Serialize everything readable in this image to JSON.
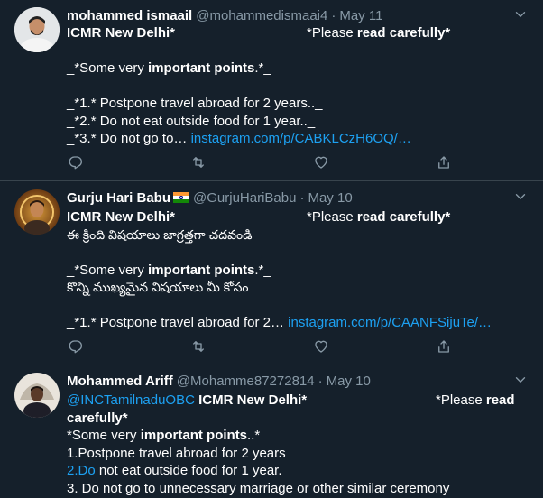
{
  "tweets": [
    {
      "name": "mohammed ismaail",
      "handle": "@mohammedismaai4",
      "dot": "·",
      "date": "May 11",
      "lines": {
        "l1a": "ICMR New Delhi*",
        "l1b": "*Please ",
        "l1c": "read carefully*",
        "l3a": "_*Some very ",
        "l3b": "important points",
        "l3c": ".*_",
        "l5": "_*1.* Postpone travel abroad for 2 years.._",
        "l6": "_*2.* Do not eat outside food for 1 year.._",
        "l7a": "_*3.* Do not go to… ",
        "l7b": "instagram.com/p/CABKLCzH6OQ/…"
      }
    },
    {
      "name": "Gurju Hari Babu",
      "flag": "india-flag",
      "handle": "@GurjuHariBabu",
      "dot": "·",
      "date": "May 10",
      "lines": {
        "l1a": "ICMR New Delhi*",
        "l1b": "*Please ",
        "l1c": "read carefully*",
        "l2": "ఈ క్రింది విషయాలు జాగ్రత్తగా చదవండి",
        "l4a": "_*Some very ",
        "l4b": "important points",
        "l4c": ".*_",
        "l5": "కొన్ని ముఖ్యమైన విషయాలు మీ కోసం",
        "l7a": "_*1.* Postpone travel abroad for 2… ",
        "l7b": "instagram.com/p/CAANFSijuTe/…"
      }
    },
    {
      "name": "Mohammed Ariff",
      "handle": "@Mohamme87272814",
      "dot": "·",
      "date": "May 10",
      "lines": {
        "l1a": "@INCTamilnaduOBC",
        "l1b": " ICMR New Delhi*",
        "l1c": "*Please ",
        "l1d": "read",
        "l2": "carefully*",
        "l3a": "*Some very ",
        "l3b": "important points",
        "l3c": "..*",
        "l4": "1.Postpone travel abroad for 2 years",
        "l5a": "2.Do",
        "l5b": " not eat outside food for 1 year.",
        "l6": "3. Do not go to unnecessary marriage or other similar ceremony"
      }
    }
  ],
  "icons": {
    "caret": "chevron-down-icon",
    "reply": "reply-icon",
    "retweet": "retweet-icon",
    "like": "heart-icon",
    "share": "share-icon"
  },
  "colors": {
    "background": "#15202b",
    "secondary_text": "#8899a6",
    "link": "#1da1f2",
    "divider": "#38444d"
  }
}
